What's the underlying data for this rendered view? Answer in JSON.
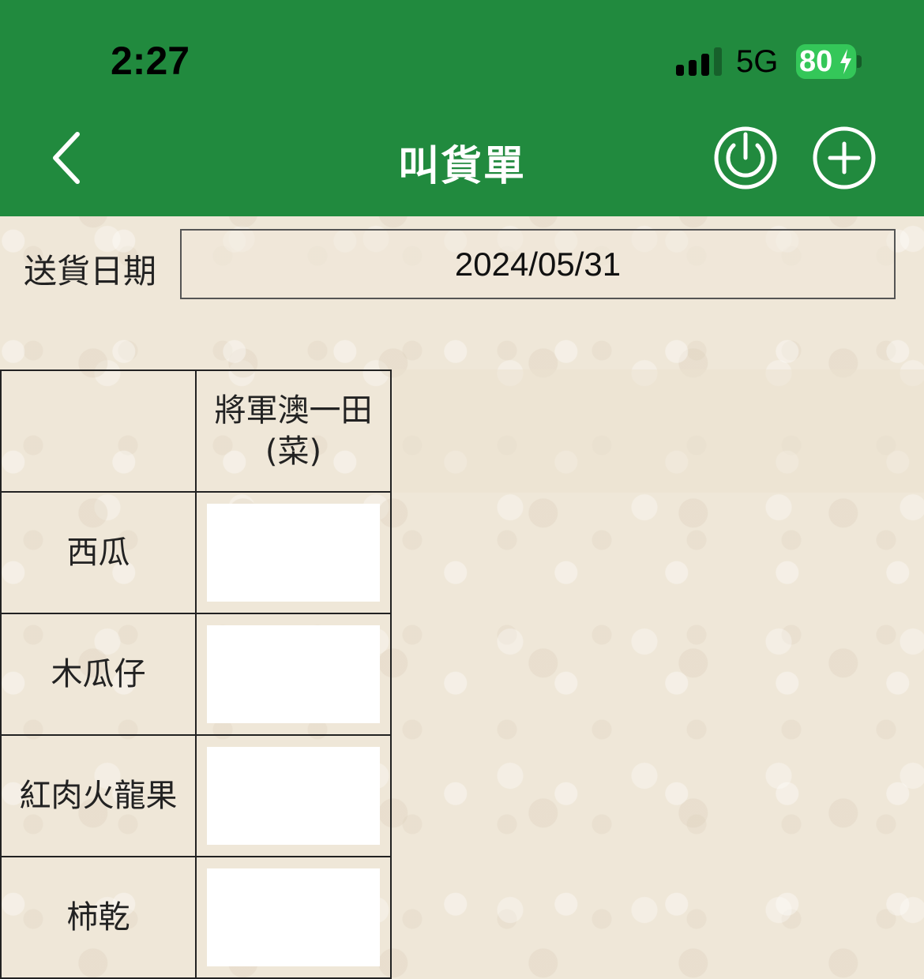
{
  "status_bar": {
    "time": "2:27",
    "network": "5G",
    "battery": "80",
    "icons": [
      "signal-icon",
      "battery-charging-icon"
    ]
  },
  "header": {
    "title": "叫貨單",
    "icons": [
      "back-chevron-icon",
      "power-icon",
      "add-circle-icon"
    ],
    "color": "#218a3e"
  },
  "delivery": {
    "label": "送貨日期",
    "date": "2024/05/31"
  },
  "order_table": {
    "column_header": [
      "將軍澳一田",
      "(菜)"
    ],
    "rows": [
      {
        "item": "西瓜",
        "quantity": ""
      },
      {
        "item": "木瓜仔",
        "quantity": ""
      },
      {
        "item": "紅肉火龍果",
        "quantity": ""
      },
      {
        "item": "柿乾",
        "quantity": ""
      }
    ]
  }
}
